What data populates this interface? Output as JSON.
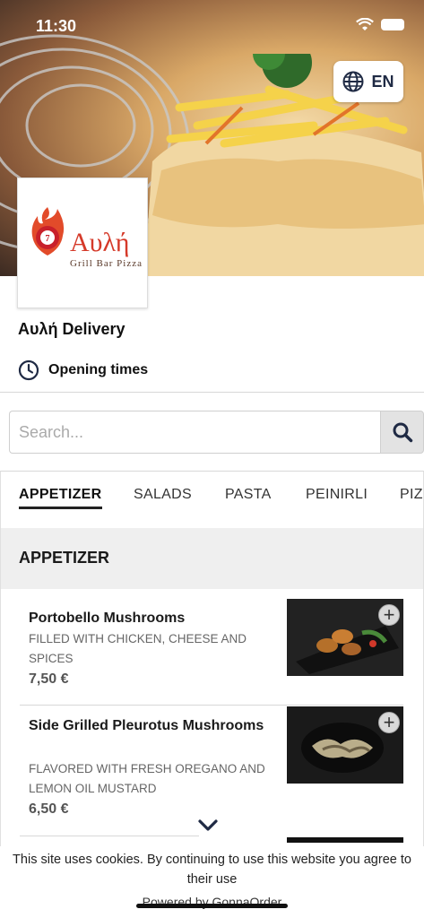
{
  "status": {
    "time": "11:30"
  },
  "hero": {
    "language_label": "EN"
  },
  "logo": {
    "name": "Αυλή",
    "subtitle": "Grill Bar Pizza"
  },
  "store": {
    "name": "Αυλή Delivery",
    "opening_times_label": "Opening times"
  },
  "search": {
    "placeholder": "Search..."
  },
  "tabs": [
    "APPETIZER",
    "SALADS",
    "PASTA",
    "PEINIRLI",
    "PIZ"
  ],
  "active_tab": "APPETIZER",
  "section": {
    "title": "APPETIZER"
  },
  "items": [
    {
      "name": "Portobello Mushrooms",
      "description": "FILLED WITH CHICKEN, CHEESE AND SPICES",
      "price": "7,50 €"
    },
    {
      "name": "Side Grilled Pleurotus Mushrooms",
      "description": "FLAVORED WITH FRESH OREGANO AND LEMON OIL MUSTARD",
      "price": "6,50 €"
    }
  ],
  "cookie": {
    "text": "This site uses cookies. By continuing to use this website you agree to their use",
    "powered_by": "Powered by GonnaOrder"
  },
  "colors": {
    "accent": "#1f2a44",
    "logo_red": "#d53a2a",
    "section_bg": "#efefef"
  }
}
